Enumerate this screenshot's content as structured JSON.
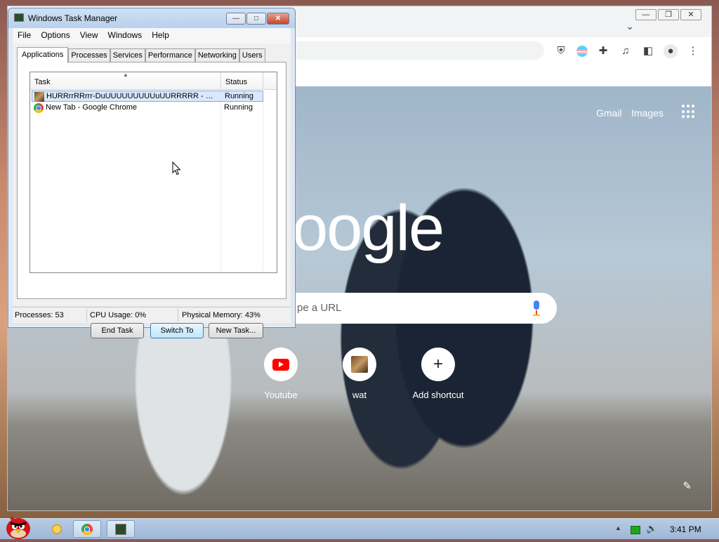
{
  "taskmgr": {
    "title": "Windows Task Manager",
    "menu": [
      "File",
      "Options",
      "View",
      "Windows",
      "Help"
    ],
    "tabs": [
      "Applications",
      "Processes",
      "Services",
      "Performance",
      "Networking",
      "Users"
    ],
    "active_tab": "Applications",
    "columns": {
      "task": "Task",
      "status": "Status"
    },
    "rows": [
      {
        "icon": "wat-thumbnail-icon",
        "task": "HURRrrRRrrr-DuUUUUUUUUUuUURRRRR - Googl...",
        "status": "Running",
        "selected": true
      },
      {
        "icon": "chrome-icon",
        "task": "New Tab - Google Chrome",
        "status": "Running",
        "selected": false
      }
    ],
    "buttons": {
      "end_task": "End Task",
      "switch_to": "Switch To",
      "new_task": "New Task..."
    },
    "status": {
      "processes": "Processes: 53",
      "cpu": "CPU Usage: 0%",
      "memory": "Physical Memory: 43%"
    }
  },
  "chrome": {
    "ntp": {
      "gmail": "Gmail",
      "images": "Images",
      "logo_text": "oogle",
      "search_placeholder": "pe a URL",
      "shortcuts": [
        {
          "label": "Youtube",
          "icon": "youtube-icon"
        },
        {
          "label": "wat",
          "icon": "wat-thumbnail-icon"
        },
        {
          "label": "Add shortcut",
          "icon": "plus-icon"
        }
      ]
    },
    "toolbar_icons": [
      "ublock-icon",
      "pride-flag-icon",
      "puzzle-extensions-icon",
      "media-queue-icon",
      "side-panel-icon",
      "profile-icon",
      "kebab-menu-icon"
    ]
  },
  "taskbar": {
    "clock": "3:41 PM"
  },
  "colors": {
    "taskbar_top": "#b7cbe3",
    "selection_bg": "#d9e8fb",
    "youtube_red": "#ff0000"
  }
}
